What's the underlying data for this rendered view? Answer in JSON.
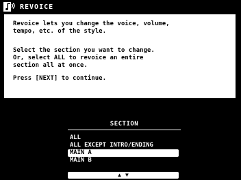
{
  "title": {
    "icon": "music-note-icon",
    "text": "REVOICE"
  },
  "instructions": {
    "para1": "Revoice lets you change the voice, volume,\ntempo, etc. of the style.",
    "para2": "Select the section you want to change.\nOr, select ALL to revoice an entire\nsection all at once.",
    "para3": "Press [NEXT] to continue."
  },
  "section": {
    "header": "SECTION",
    "options": [
      "ALL",
      "ALL EXCEPT INTRO/ENDING",
      "MAIN A",
      "MAIN B"
    ],
    "selected": "MAIN A",
    "scroll_up_icon": "triangle-up-icon",
    "scroll_down_icon": "triangle-down-icon"
  }
}
